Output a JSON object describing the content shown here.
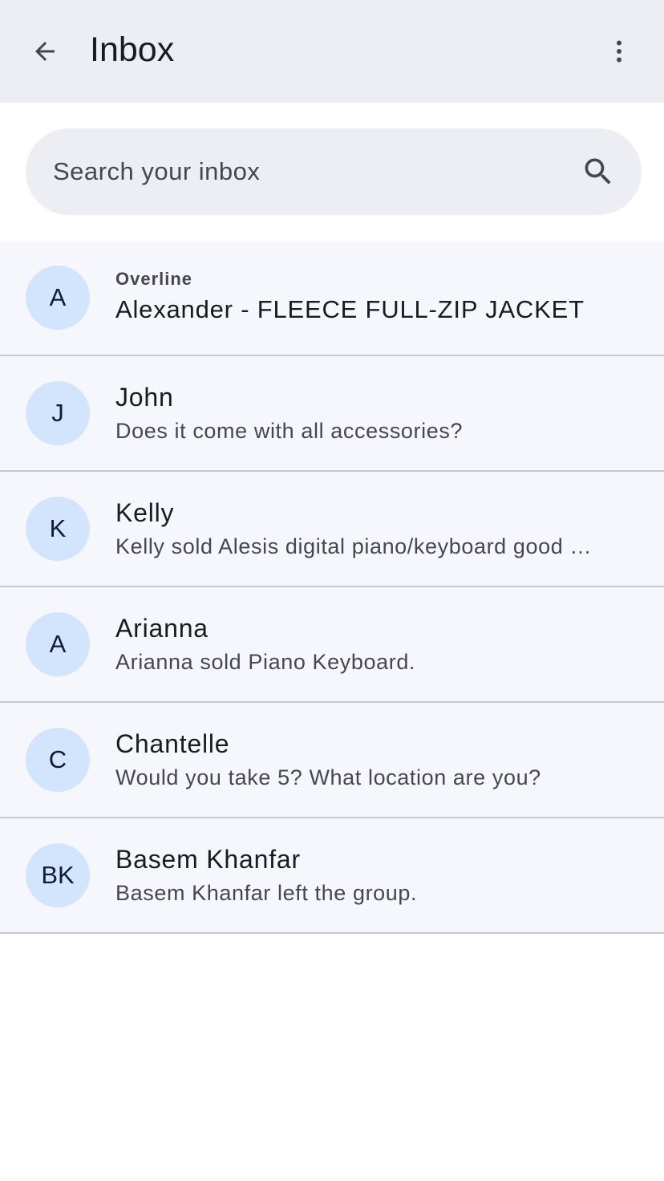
{
  "app_bar": {
    "title": "Inbox",
    "back_icon": "arrow-back-icon",
    "more_icon": "more-vert-icon"
  },
  "search": {
    "placeholder": "Search your inbox",
    "icon": "search-icon"
  },
  "conversations": [
    {
      "initials": "A",
      "overline": "Overline",
      "headline": "Alexander - FLEECE FULL-ZIP JACKET"
    },
    {
      "initials": "J",
      "headline": "John",
      "supporting": "Does it come with all accessories?"
    },
    {
      "initials": "K",
      "headline": "Kelly",
      "supporting": "Kelly sold Alesis digital piano/keyboard good condition."
    },
    {
      "initials": "A",
      "headline": "Arianna",
      "supporting": "Arianna sold Piano Keyboard."
    },
    {
      "initials": "C",
      "headline": "Chantelle",
      "supporting": "Would you take 5? What location are you?"
    },
    {
      "initials": "BK",
      "headline": "Basem Khanfar",
      "supporting": "Basem Khanfar left the group."
    }
  ],
  "colors": {
    "app_bar_bg": "#eceef4",
    "search_bg": "#eceef3",
    "list_bg": "#f6f7fc",
    "avatar_bg": "#d3e4fd",
    "divider": "#c6c8cf"
  }
}
